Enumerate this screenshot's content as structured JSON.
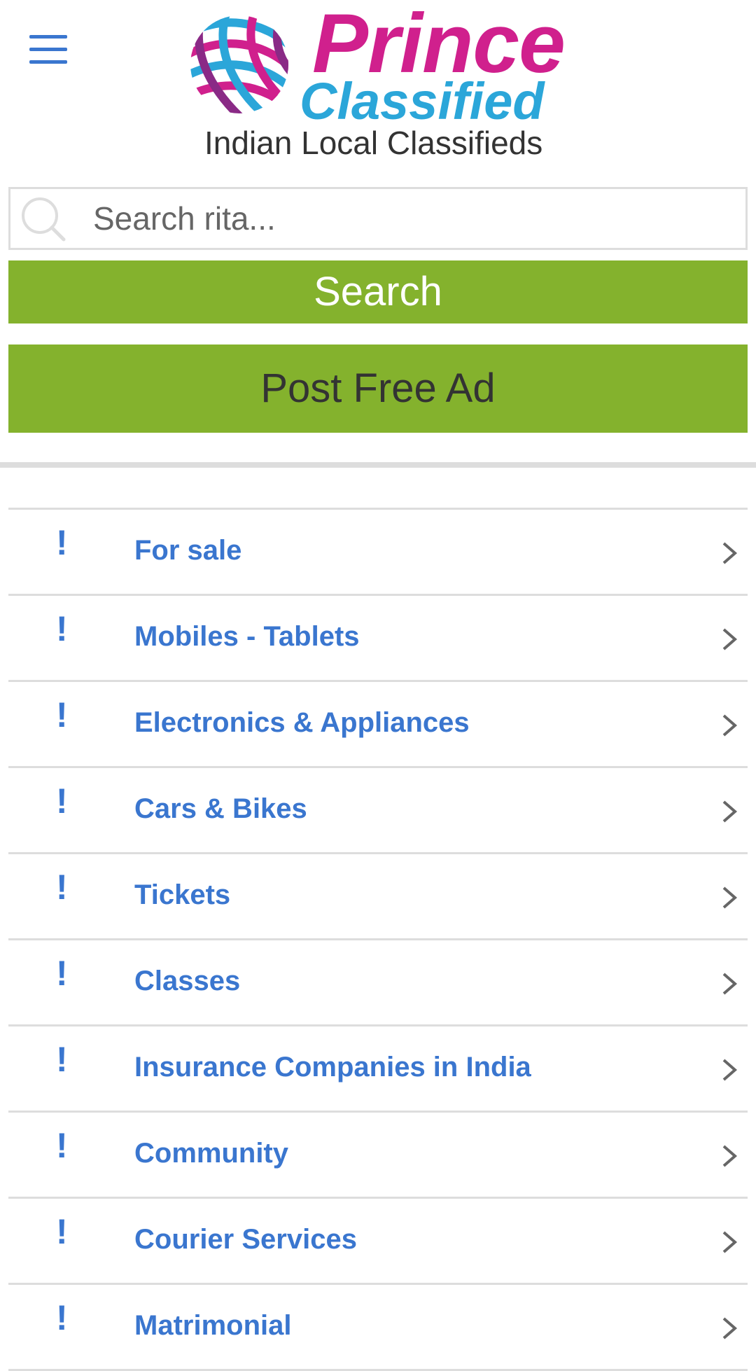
{
  "header": {
    "logo_word_1": "Prince",
    "logo_word_2": "Classified",
    "tagline": "Indian Local Classifieds",
    "menu_icon": "hamburger-menu-icon"
  },
  "colors": {
    "brand_pink": "#d0208d",
    "brand_blue": "#2ba6d9",
    "button_green": "#84b22d",
    "link_blue": "#3a76cf",
    "divider_gray": "#dddddd"
  },
  "search": {
    "placeholder": "Search rita...",
    "value": "",
    "icon": "search-icon",
    "button_label": "Search"
  },
  "post_ad": {
    "label": "Post Free Ad"
  },
  "categories": {
    "items": [
      {
        "marker": "!",
        "label": "For sale"
      },
      {
        "marker": "!",
        "label": "Mobiles - Tablets"
      },
      {
        "marker": "!",
        "label": "Electronics & Appliances"
      },
      {
        "marker": "!",
        "label": "Cars & Bikes"
      },
      {
        "marker": "!",
        "label": "Tickets"
      },
      {
        "marker": "!",
        "label": "Classes"
      },
      {
        "marker": "!",
        "label": "Insurance Companies in India"
      },
      {
        "marker": "!",
        "label": "Community"
      },
      {
        "marker": "!",
        "label": "Courier Services"
      },
      {
        "marker": "!",
        "label": "Matrimonial"
      }
    ],
    "chevron_icon": "chevron-right-icon"
  }
}
